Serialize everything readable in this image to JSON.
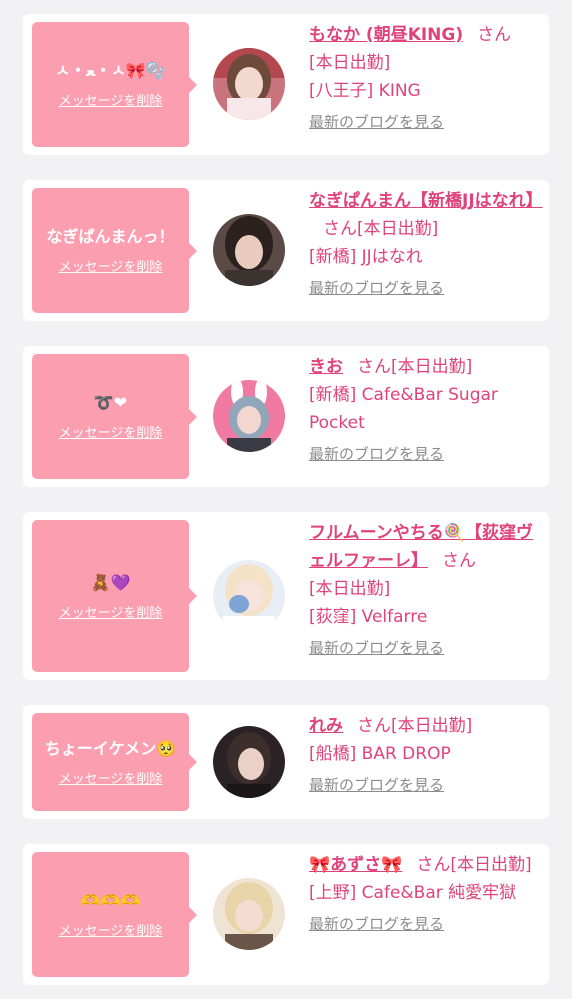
{
  "colors": {
    "accent": "#e0437a",
    "bubble": "#fb9eb0",
    "muted": "#8b8b8b"
  },
  "cards": [
    {
      "message": "ㅅ・ﻌ・ㅅ🎀🫧",
      "delete": "メッセージを削除",
      "name": "もなか (朝昼KING)",
      "san": "さん",
      "status": "[本日出勤]",
      "shop": "[八王子] KING",
      "blog": "最新のブログを見る"
    },
    {
      "message": "なぎぱんまんっ！",
      "delete": "メッセージを削除",
      "name": "なぎぱんまん【新橋JJはなれ】",
      "san": "さん",
      "status": "[本日出勤]",
      "shop": "[新橋] JJはなれ",
      "blog": "最新のブログを見る"
    },
    {
      "message": "➰❤",
      "delete": "メッセージを削除",
      "name": "きお",
      "san": "さん",
      "status": "[本日出勤]",
      "shop": "[新橋] Cafe&Bar Sugar Pocket",
      "blog": "最新のブログを見る"
    },
    {
      "message": "🧸💜",
      "delete": "メッセージを削除",
      "name": "フルムーンやちる🍭【荻窪ヴェルファーレ】",
      "san": "さん",
      "status": "[本日出勤]",
      "shop": "[荻窪] Velfarre",
      "blog": "最新のブログを見る"
    },
    {
      "message": "ちょーイケメン🥺",
      "delete": "メッセージを削除",
      "name": "れみ",
      "san": "さん",
      "status": "[本日出勤]",
      "shop": "[船橋] BAR DROP",
      "blog": "最新のブログを見る"
    },
    {
      "message": "🫶🫶🫶",
      "delete": "メッセージを削除",
      "name": "🎀あずさ🎀",
      "san": "さん",
      "status": "[本日出勤]",
      "shop": "[上野] Cafe&Bar 純愛牢獄",
      "blog": "最新のブログを見る"
    }
  ]
}
